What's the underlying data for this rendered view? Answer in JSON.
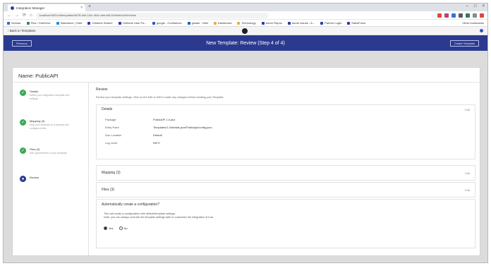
{
  "browser": {
    "tab_title": "Integration Manager",
    "tab_close": "×",
    "new_tab": "+",
    "window_controls": [
      "–",
      "□",
      "×"
    ],
    "url": "localhost:5001/ui/templates/5678-9a4-1f1e-4b2e-bde4d5-f2c9c6e0c2e/review",
    "nav": [
      "←",
      "→",
      "⟳",
      "⌂"
    ],
    "extension_colors": [
      "#e04a3a",
      "#c93b7a",
      "#3a71d9",
      "#5b5b5b",
      "#2f7d5a",
      "#8a8a8a",
      "#d44"
    ],
    "bookmarks": [
      {
        "label": "Scholar",
        "color": "#3566c9"
      },
      {
        "label": "Plus / OneDrive",
        "color": "#2a8a55"
      },
      {
        "label": "Salesforce | Orbit",
        "color": "#1a8ed9"
      },
      {
        "label": "Orbitone Search",
        "color": "#2f3aa5"
      },
      {
        "label": "Orbitone User Pa...",
        "color": "#2f3aa5"
      },
      {
        "label": "google - Confluence",
        "color": "#2c57b3"
      },
      {
        "label": "gluster - Wiki",
        "color": "#1c5fbf"
      },
      {
        "label": "Dashboard",
        "color": "#e2b33a"
      },
      {
        "label": "Technology",
        "color": "#e2b33a"
      },
      {
        "label": "Azure Repos",
        "color": "#2f3aa5"
      },
      {
        "label": "Azure Issues - A...",
        "color": "#2f3aa5"
      },
      {
        "label": "Partner Login",
        "color": "#2f3aa5"
      },
      {
        "label": "SalesForce",
        "color": "#2f3aa5"
      }
    ],
    "bookmarks_right": "Other bookmarks"
  },
  "app": {
    "back_link": "‹ Back to Templates",
    "header_title": "New Template: Review (Step 4 of 4)",
    "previous_button": "Previous",
    "create_button": "Create Template",
    "template_name": "Name: PublicAPI"
  },
  "steps": [
    {
      "label": "Details",
      "desc": "Define your integration template and settings",
      "status": "done",
      "icon": "✓"
    },
    {
      "label": "Mapping (3)",
      "desc": "Map your template to a schema and configure fields",
      "status": "done",
      "icon": "✓"
    },
    {
      "label": "Files (3)",
      "desc": "Add optional files to your template",
      "status": "done",
      "icon": "✓"
    },
    {
      "label": "Review",
      "desc": "",
      "status": "current",
      "icon": "●"
    }
  ],
  "review": {
    "title": "Review",
    "description": "Review your template settings. Click on the Edit or Edit to make any changes before creating your Template.",
    "details_panel": {
      "title": "Details",
      "edit_label": "Edit",
      "rows": [
        {
          "key": "Package",
          "value": "PublicAPI 1.0.pkz"
        },
        {
          "key": "Entry Point",
          "value": "Templates/1.0/details.json/Publicapi/config.json"
        },
        {
          "key": "Doc Location",
          "value": "Default"
        },
        {
          "key": "Log Level",
          "value": "INFO"
        }
      ]
    },
    "mapping_panel": {
      "title": "Mapping (3)",
      "edit_label": "Edit"
    },
    "files_panel": {
      "title": "Files (3)",
      "edit_label": "Edit"
    },
    "auto_config": {
      "title": "Automatically create a configuration?",
      "line1": "This will create a configuration with default/template settings.",
      "line2": "Note: you can always override the template settings later to customize the integration of it as.",
      "options": [
        {
          "label": "Yes",
          "selected": true
        },
        {
          "label": "No",
          "selected": false
        }
      ]
    }
  }
}
